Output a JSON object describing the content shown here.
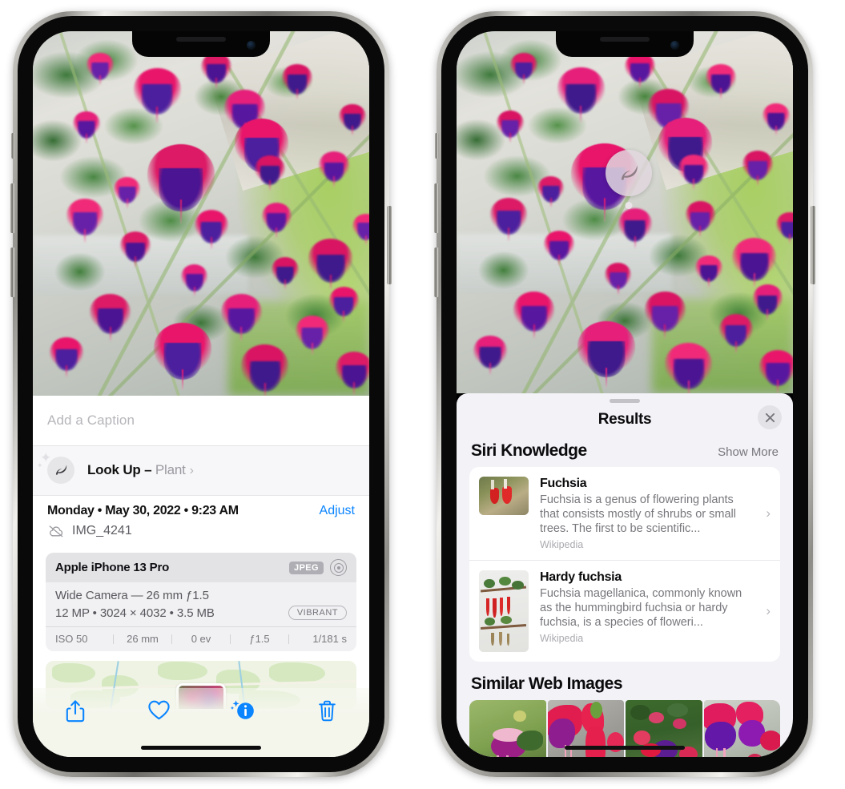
{
  "left_phone": {
    "caption": {
      "placeholder": "Add a Caption",
      "value": ""
    },
    "lookup": {
      "label": "Look Up",
      "dash": "–",
      "subject": "Plant",
      "chevron": "›",
      "icon": "leaf-icon"
    },
    "metadata": {
      "date": "Monday • May 30, 2022 • 9:23 AM",
      "adjust_label": "Adjust",
      "filename": "IMG_4241",
      "cloud_icon": "cloud-slash-icon"
    },
    "camera_card": {
      "device": "Apple iPhone 13 Pro",
      "format_badge": "JPEG",
      "hdr_icon": "hdr-aperture-icon",
      "lens_line": "Wide Camera — 26 mm ƒ1.5",
      "specs_line": "12 MP • 3024 × 4032 • 3.5 MB",
      "style_badge": "VIBRANT",
      "exif": [
        "ISO 50",
        "26 mm",
        "0 ev",
        "ƒ1.5",
        "1/181 s"
      ]
    },
    "toolbar": [
      {
        "name": "share-icon",
        "label": "Share"
      },
      {
        "name": "heart-icon",
        "label": "Favorite"
      },
      {
        "name": "info-sparkle-icon",
        "label": "Info"
      },
      {
        "name": "trash-icon",
        "label": "Delete"
      }
    ]
  },
  "right_phone": {
    "visual_lookup_badge": {
      "icon": "leaf-icon"
    },
    "sheet": {
      "title": "Results",
      "close_icon": "close-icon",
      "sections": [
        {
          "title": "Siri Knowledge",
          "action_label": "Show More",
          "items": [
            {
              "name": "Fuchsia",
              "description": "Fuchsia is a genus of flowering plants that consists mostly of shrubs or small trees. The first to be scientific...",
              "source": "Wikipedia",
              "chevron": "›"
            },
            {
              "name": "Hardy fuchsia",
              "description": "Fuchsia magellanica, commonly known as the hummingbird fuchsia or hardy fuchsia, is a species of floweri...",
              "source": "Wikipedia",
              "chevron": "›"
            }
          ]
        },
        {
          "title": "Similar Web Images",
          "thumbnails": [
            {
              "alt": "fuchsia-flower-1"
            },
            {
              "alt": "fuchsia-flower-2"
            },
            {
              "alt": "fuchsia-flower-3"
            },
            {
              "alt": "fuchsia-flower-4"
            }
          ]
        }
      ]
    }
  },
  "colors": {
    "accent_blue": "#0a84ff",
    "sheet_bg": "#f2f2f7",
    "card_bg": "#ffffff",
    "secondary_text": "#77777d",
    "magenta": "#e8156b",
    "purple": "#4b1f9e"
  }
}
